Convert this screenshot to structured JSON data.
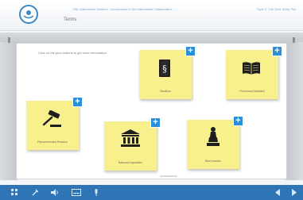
{
  "header": {
    "logo": "logo-icon",
    "top_title": "PAL Nationwide Sentinel - Introduction to the Nationwide Collaborative ...",
    "top_right_title": "Topic 2: The Role of the PAL",
    "page_title": "Terms"
  },
  "main": {
    "instruction": "Click on the plus buttons to get more information.",
    "notes": [
      {
        "label": "Sandbox",
        "icon": "section-book-icon"
      },
      {
        "label": "Functional Standard",
        "icon": "open-book-icon"
      },
      {
        "label": "Recommended Practice",
        "icon": "gavel-icon"
      },
      {
        "label": "National Legislation",
        "icon": "government-building-icon"
      },
      {
        "label": "Best practice",
        "icon": "award-icon"
      }
    ]
  },
  "footer": {
    "icons": [
      "grid-icon",
      "settings-icon",
      "volume-icon",
      "captions-icon",
      "microphone-icon",
      "previous-icon",
      "next-icon"
    ]
  },
  "colors": {
    "accent": "#2f74b5",
    "note": "#f8f08c",
    "plus": "#2a8fd8"
  }
}
